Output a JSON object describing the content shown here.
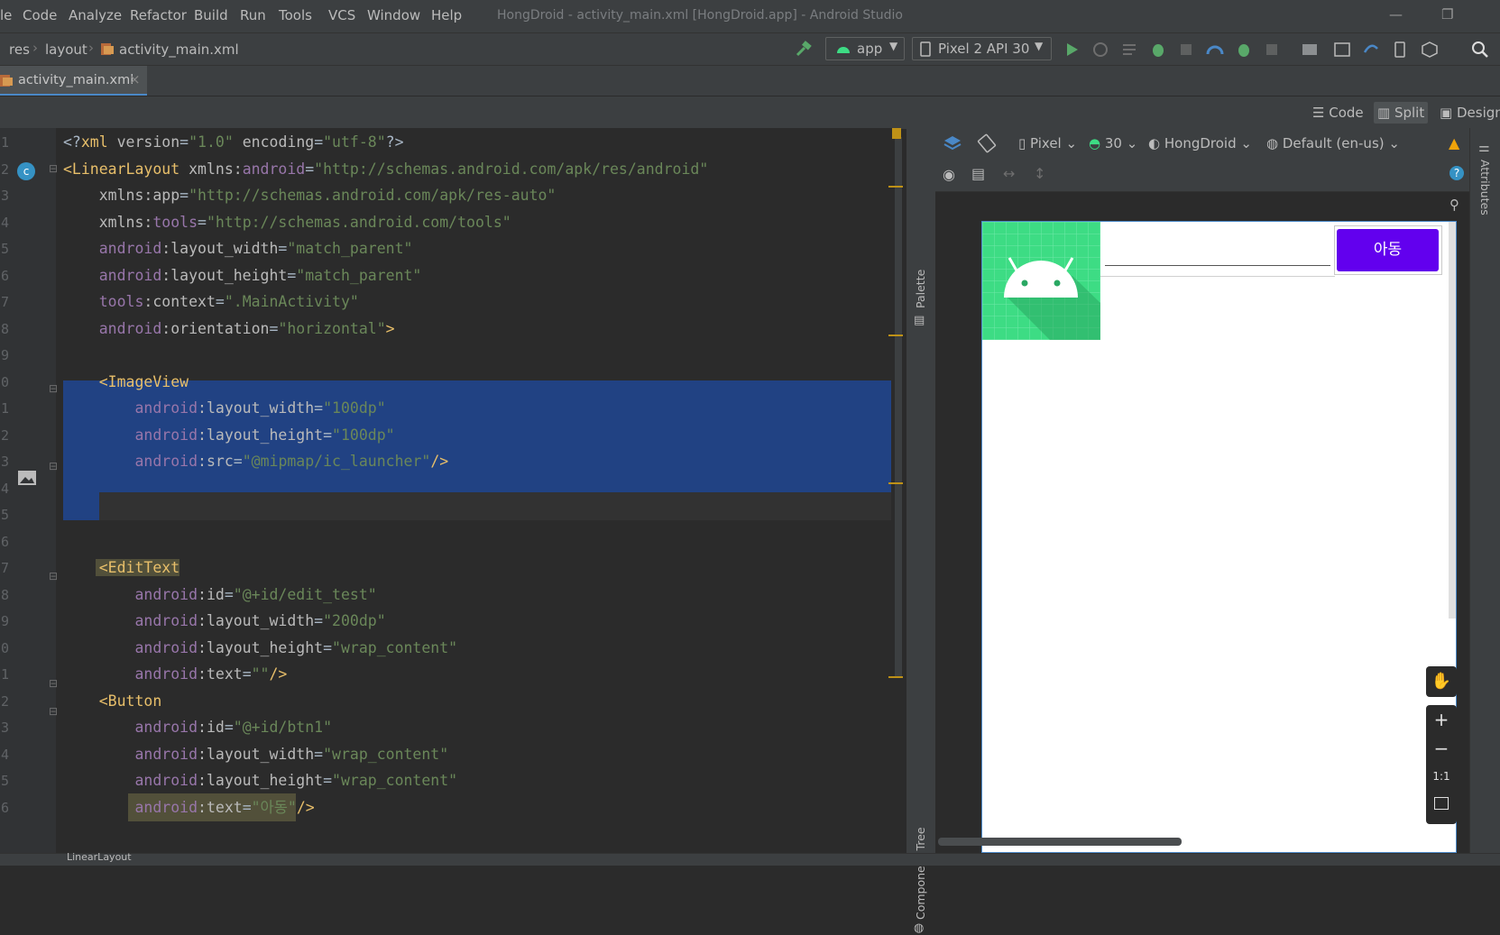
{
  "menu": {
    "items": [
      "le",
      "Code",
      "Analyze",
      "Refactor",
      "Build",
      "Run",
      "Tools",
      "VCS",
      "Window",
      "Help"
    ],
    "window_title": "HongDroid - activity_main.xml [HongDroid.app] - Android Studio"
  },
  "nav": {
    "breadcrumbs": [
      "res",
      "layout",
      "activity_main.xml"
    ],
    "run_config": "app",
    "device": "Pixel 2 API 30"
  },
  "tabs": [
    {
      "label": "activity_main.xml",
      "close": "×"
    }
  ],
  "view_modes": {
    "code": "Code",
    "split": "Split",
    "design": "Design"
  },
  "editor": {
    "line_numbers": [
      "1",
      "2",
      "3",
      "4",
      "5",
      "6",
      "7",
      "8",
      "9",
      "0",
      "1",
      "2",
      "3",
      "4",
      "5",
      "6",
      "7",
      "8",
      "9",
      "0",
      "1",
      "2",
      "3",
      "4",
      "5",
      "6"
    ],
    "lines": [
      [
        [
          "plain",
          "<?"
        ],
        [
          "tag",
          "xml"
        ],
        [
          "attr",
          " version"
        ],
        [
          "plain",
          "="
        ],
        [
          "val",
          "\"1.0\""
        ],
        [
          "attr",
          " encoding"
        ],
        [
          "plain",
          "="
        ],
        [
          "val",
          "\"utf-8\""
        ],
        [
          "plain",
          "?>"
        ]
      ],
      [
        [
          "tag",
          "<LinearLayout "
        ],
        [
          "attr",
          "xmlns:"
        ],
        [
          "ns",
          "android"
        ],
        [
          "plain",
          "="
        ],
        [
          "val",
          "\"http://schemas.android.com/apk/res/android\""
        ]
      ],
      [
        [
          "attr",
          "    xmlns:app"
        ],
        [
          "plain",
          "="
        ],
        [
          "val",
          "\"http://schemas.android.com/apk/res-auto\""
        ]
      ],
      [
        [
          "attr",
          "    xmlns:"
        ],
        [
          "ns",
          "tools"
        ],
        [
          "plain",
          "="
        ],
        [
          "val",
          "\"http://schemas.android.com/tools\""
        ]
      ],
      [
        [
          "ns",
          "    android"
        ],
        [
          "attr",
          ":layout_width"
        ],
        [
          "plain",
          "="
        ],
        [
          "val",
          "\"match_parent\""
        ]
      ],
      [
        [
          "ns",
          "    android"
        ],
        [
          "attr",
          ":layout_height"
        ],
        [
          "plain",
          "="
        ],
        [
          "val",
          "\"match_parent\""
        ]
      ],
      [
        [
          "ns",
          "    tools"
        ],
        [
          "attr",
          ":context"
        ],
        [
          "plain",
          "="
        ],
        [
          "val",
          "\".MainActivity\""
        ]
      ],
      [
        [
          "ns",
          "    android"
        ],
        [
          "attr",
          ":orientation"
        ],
        [
          "plain",
          "="
        ],
        [
          "val",
          "\"horizontal\""
        ],
        [
          "tag",
          ">"
        ]
      ],
      [
        [
          "plain",
          ""
        ]
      ],
      [
        [
          "tag",
          "    <ImageView"
        ]
      ],
      [
        [
          "ns",
          "        android"
        ],
        [
          "attr",
          ":layout_width"
        ],
        [
          "plain",
          "="
        ],
        [
          "val",
          "\"100dp\""
        ]
      ],
      [
        [
          "ns",
          "        android"
        ],
        [
          "attr",
          ":layout_height"
        ],
        [
          "plain",
          "="
        ],
        [
          "val",
          "\"100dp\""
        ]
      ],
      [
        [
          "ns",
          "        android"
        ],
        [
          "attr",
          ":src"
        ],
        [
          "plain",
          "="
        ],
        [
          "val",
          "\"@mipmap/ic_launcher\""
        ],
        [
          "tag",
          "/>"
        ]
      ],
      [
        [
          "plain",
          ""
        ]
      ],
      [
        [
          "plain",
          ""
        ]
      ],
      [
        [
          "plain",
          ""
        ]
      ],
      [
        [
          "tag",
          "    <EditText"
        ]
      ],
      [
        [
          "ns",
          "        android"
        ],
        [
          "attr",
          ":id"
        ],
        [
          "plain",
          "="
        ],
        [
          "val",
          "\"@+id/edit_test\""
        ]
      ],
      [
        [
          "ns",
          "        android"
        ],
        [
          "attr",
          ":layout_width"
        ],
        [
          "plain",
          "="
        ],
        [
          "val",
          "\"200dp\""
        ]
      ],
      [
        [
          "ns",
          "        android"
        ],
        [
          "attr",
          ":layout_height"
        ],
        [
          "plain",
          "="
        ],
        [
          "val",
          "\"wrap_content\""
        ]
      ],
      [
        [
          "ns",
          "        android"
        ],
        [
          "attr",
          ":text"
        ],
        [
          "plain",
          "="
        ],
        [
          "val",
          "\"\""
        ],
        [
          "tag",
          "/>"
        ]
      ],
      [
        [
          "tag",
          "    <Button"
        ]
      ],
      [
        [
          "ns",
          "        android"
        ],
        [
          "attr",
          ":id"
        ],
        [
          "plain",
          "="
        ],
        [
          "val",
          "\"@+id/btn1\""
        ]
      ],
      [
        [
          "ns",
          "        android"
        ],
        [
          "attr",
          ":layout_width"
        ],
        [
          "plain",
          "="
        ],
        [
          "val",
          "\"wrap_content\""
        ]
      ],
      [
        [
          "ns",
          "        android"
        ],
        [
          "attr",
          ":layout_height"
        ],
        [
          "plain",
          "="
        ],
        [
          "val",
          "\"wrap_content\""
        ]
      ],
      [
        [
          "ns",
          "        android"
        ],
        [
          "attr",
          ":text"
        ],
        [
          "plain",
          "="
        ],
        [
          "val",
          "\"아동\""
        ],
        [
          "tag",
          "/>"
        ]
      ]
    ]
  },
  "side_panels": {
    "palette": "Palette",
    "component_tree": "Component Tree",
    "attributes": "Attributes"
  },
  "design_toolbar": {
    "device": "Pixel",
    "api": "30",
    "theme": "HongDroid",
    "locale": "Default (en-us)"
  },
  "preview": {
    "button_text": "아동"
  },
  "zoom": {
    "plus": "+",
    "minus": "−",
    "one_to_one": "1:1"
  },
  "status": {
    "text": "LinearLayout"
  },
  "colors": {
    "accent": "#4a88c7",
    "selection": "#214283",
    "button": "#6200ee",
    "android_green": "#3ddc84"
  }
}
